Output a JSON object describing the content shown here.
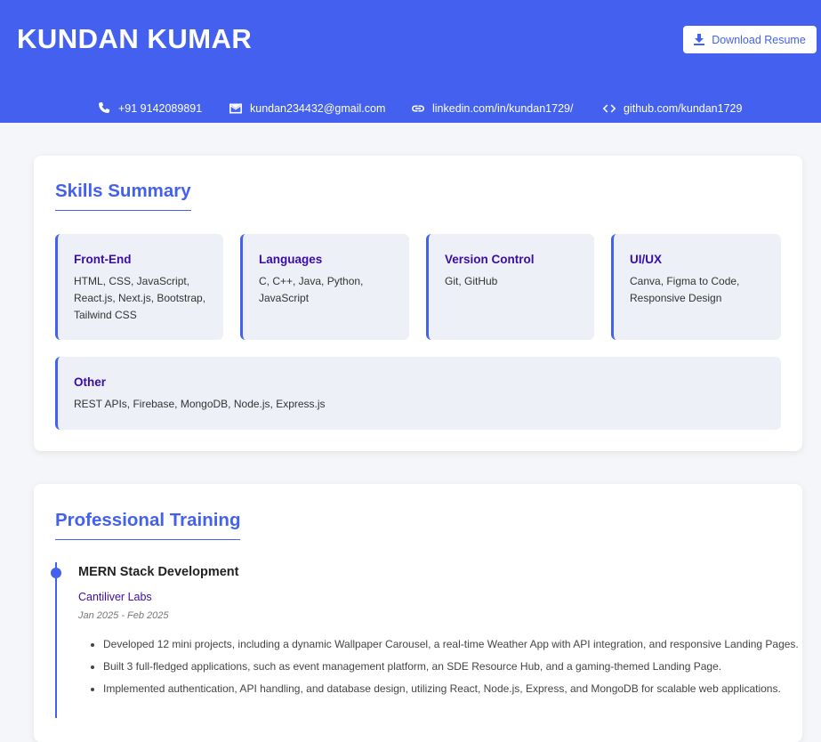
{
  "header": {
    "name": "KUNDAN KUMAR",
    "download_label": "Download Resume",
    "contacts": [
      {
        "icon": "phone-icon",
        "text": "+91 9142089891"
      },
      {
        "icon": "mail-icon",
        "text": "kundan234432@gmail.com"
      },
      {
        "icon": "link-icon",
        "text": "linkedin.com/in/kundan1729/"
      },
      {
        "icon": "code-icon",
        "text": "github.com/kundan1729"
      }
    ]
  },
  "skills": {
    "title": "Skills Summary",
    "items": [
      {
        "title": "Front-End",
        "items": "HTML, CSS, JavaScript, React.js, Next.js, Bootstrap, Tailwind CSS"
      },
      {
        "title": "Languages",
        "items": "C, C++, Java, Python, JavaScript"
      },
      {
        "title": "Version Control",
        "items": "Git, GitHub"
      },
      {
        "title": "UI/UX",
        "items": "Canva, Figma to Code, Responsive Design"
      },
      {
        "title": "Other",
        "items": "REST APIs, Firebase, MongoDB, Node.js, Express.js"
      }
    ]
  },
  "training": {
    "title": "Professional Training",
    "entries": [
      {
        "title": "MERN Stack Development",
        "org": "Cantiliver Labs",
        "date": "Jan 2025 - Feb 2025",
        "bullets": [
          "Developed 12 mini projects, including a dynamic Wallpaper Carousel, a real-time Weather App with API integration, and responsive Landing Pages.",
          "Built 3 full-fledged applications, such as event management platform, an SDE Resource Hub, and a gaming-themed Landing Page.",
          "Implemented authentication, API handling, and database design, utilizing React, Node.js, Express, and MongoDB for scalable web applications."
        ]
      }
    ]
  },
  "colors": {
    "accent": "#4361ee",
    "heading_purple": "#3a0ca3",
    "skill_bg": "#edf1f7",
    "page_bg": "#f5f6f9"
  }
}
